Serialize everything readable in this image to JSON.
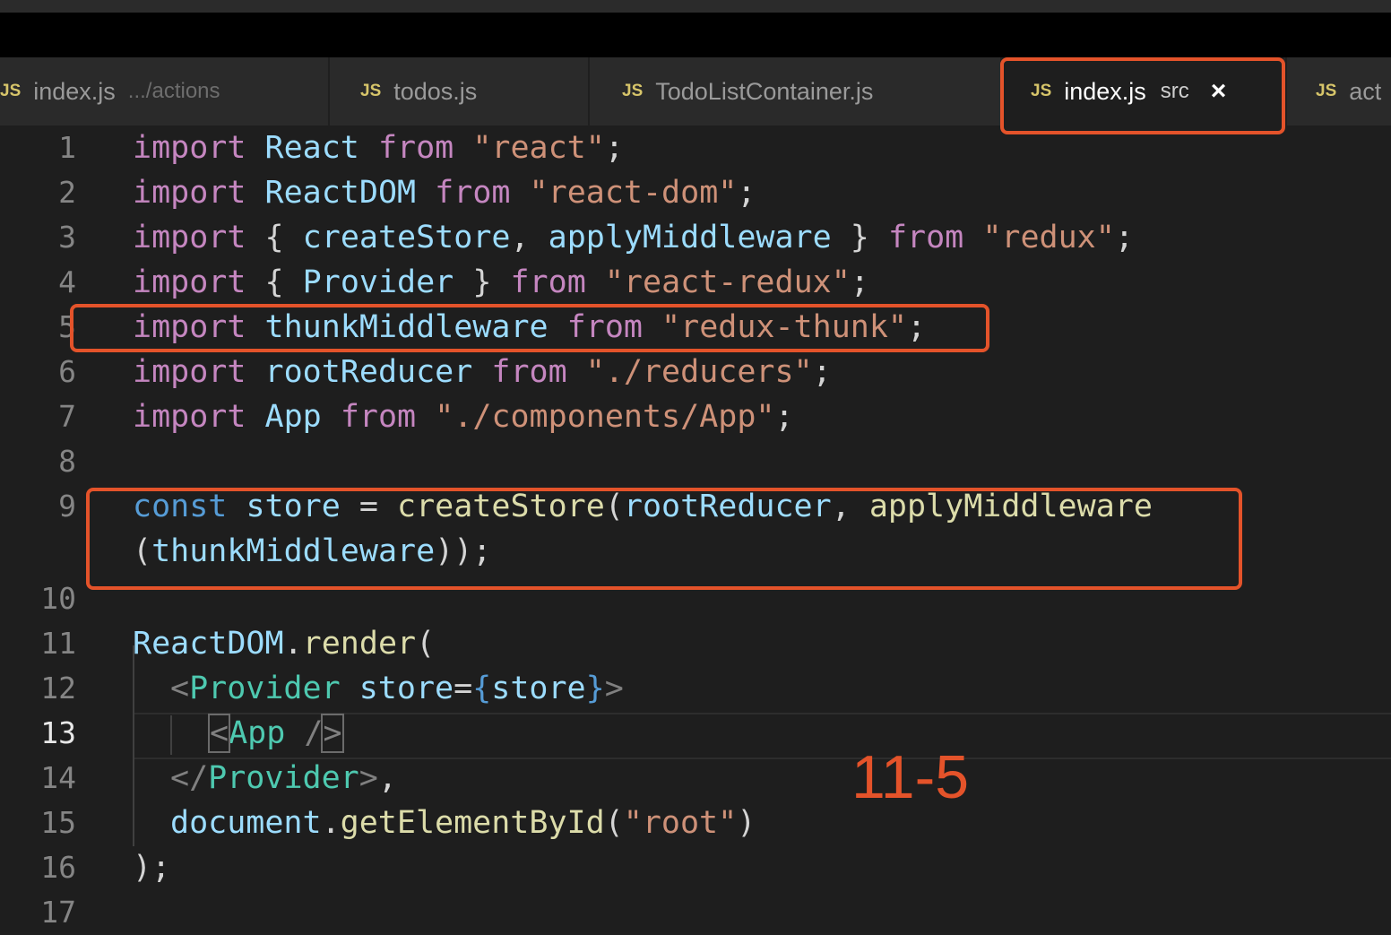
{
  "tabs": [
    {
      "icon": "JS",
      "name": "index.js",
      "desc": ".../actions"
    },
    {
      "icon": "JS",
      "name": "todos.js",
      "desc": ""
    },
    {
      "icon": "JS",
      "name": "TodoListContainer.js",
      "desc": ""
    },
    {
      "icon": "JS",
      "name": "index.js",
      "desc": "src",
      "close": "×",
      "active": true
    },
    {
      "icon": "JS",
      "name": "act",
      "desc": ""
    }
  ],
  "line_numbers": [
    "1",
    "2",
    "3",
    "4",
    "5",
    "6",
    "7",
    "8",
    "9",
    "",
    "10",
    "11",
    "12",
    "13",
    "14",
    "15",
    "16",
    "17"
  ],
  "code": {
    "l1": [
      "import",
      "React",
      "from",
      "\"react\"",
      ";"
    ],
    "l2": [
      "import",
      "ReactDOM",
      "from",
      "\"react-dom\"",
      ";"
    ],
    "l3": [
      "import",
      "{ ",
      "createStore",
      ", ",
      "applyMiddleware",
      " }",
      "from",
      "\"redux\"",
      ";"
    ],
    "l4": [
      "import",
      "{ ",
      "Provider",
      " }",
      "from",
      "\"react-redux\"",
      ";"
    ],
    "l5": [
      "import",
      "thunkMiddleware",
      "from",
      "\"redux-thunk\"",
      ";"
    ],
    "l6": [
      "import",
      "rootReducer",
      "from",
      "\"./reducers\"",
      ";"
    ],
    "l7": [
      "import",
      "App",
      "from",
      "\"./components/App\"",
      ";"
    ],
    "l9a": [
      "const",
      "store",
      " = ",
      "createStore",
      "(",
      "rootReducer",
      ", ",
      "applyMiddleware"
    ],
    "l9b": [
      "(",
      "thunkMiddleware",
      "));"
    ],
    "l11": [
      "ReactDOM",
      ".",
      "render",
      "("
    ],
    "l12": [
      "<",
      "Provider",
      "store",
      "=",
      "{",
      "store",
      "}",
      ">"
    ],
    "l13": [
      "<",
      "App",
      " /",
      ">"
    ],
    "l14": [
      "</",
      "Provider",
      ">",
      ","
    ],
    "l15": [
      "document",
      ".",
      "getElementById",
      "(",
      "\"root\"",
      ")"
    ],
    "l16": [
      ");"
    ]
  },
  "annotation": {
    "label": "11-5",
    "color": "#e4532a"
  },
  "colors": {
    "keyword": "#c586c0",
    "const": "#569cd6",
    "identifier": "#9cdcfe",
    "function": "#dcdcaa",
    "string": "#ce9178",
    "tag": "#4ec9b0",
    "highlight_box": "#e4532a"
  }
}
